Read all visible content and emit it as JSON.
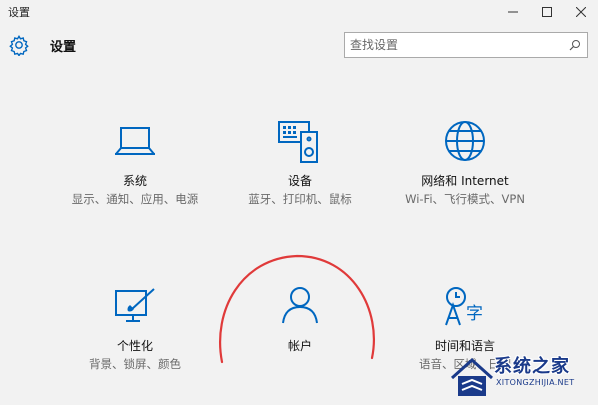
{
  "window": {
    "title": "设置",
    "controls": [
      "minimize-icon",
      "maximize-icon",
      "close-icon"
    ]
  },
  "header": {
    "icon": "gear-icon",
    "title": "设置"
  },
  "search": {
    "placeholder": "查找设置",
    "icon": "search-icon"
  },
  "accent_color": "#0067c0",
  "tiles": [
    {
      "icon": "laptop-icon",
      "name": "系统",
      "desc": "显示、通知、应用、电源"
    },
    {
      "icon": "devices-icon",
      "name": "设备",
      "desc": "蓝牙、打印机、鼠标"
    },
    {
      "icon": "globe-icon",
      "name": "网络和 Internet",
      "desc": "Wi-Fi、飞行模式、VPN"
    },
    {
      "icon": "personalization-icon",
      "name": "个性化",
      "desc": "背景、锁屏、颜色"
    },
    {
      "icon": "account-icon",
      "name": "帐户",
      "desc": ""
    },
    {
      "icon": "time-language-icon",
      "name": "时间和语言",
      "desc": "语音、区域、日期"
    }
  ],
  "annotation_color": "#e03a3a",
  "watermark": {
    "main": "系统之家",
    "sub": "XITONGZHIJIA.NET"
  }
}
